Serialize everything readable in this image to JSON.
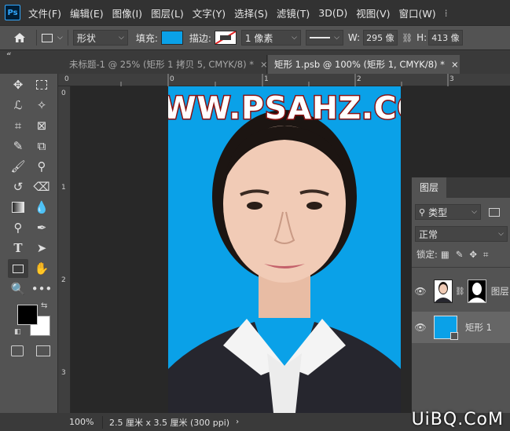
{
  "menubar": {
    "logo": "Ps",
    "items": [
      "文件(F)",
      "编辑(E)",
      "图像(I)",
      "图层(L)",
      "文字(Y)",
      "选择(S)",
      "滤镜(T)",
      "3D(D)",
      "视图(V)",
      "窗口(W)"
    ]
  },
  "options": {
    "mode": "形状",
    "fill_label": "填充:",
    "stroke_label": "描边:",
    "stroke_width": "1 像素",
    "w_label": "W:",
    "w_value": "295 像",
    "h_label": "H:",
    "h_value": "413 像",
    "fill_color": "#0aa1e8"
  },
  "tabs": [
    {
      "label": "未标题-1 @ 25% (矩形 1 拷贝 5, CMYK/8) *",
      "close": "×"
    },
    {
      "label": "矩形 1.psb @ 100% (矩形 1, CMYK/8) *",
      "close": "×"
    }
  ],
  "collapse_glyph": "«",
  "rulers": {
    "top": [
      "0",
      "0",
      "1",
      "2",
      "3"
    ],
    "left": [
      "0",
      "1",
      "2",
      "3"
    ]
  },
  "canvas": {
    "headline": "WWW.PSAHZ.COM",
    "background_color": "#0aa1e8"
  },
  "layers_panel": {
    "title": "图层",
    "filter_kind": "类型",
    "blend_mode": "正常",
    "lock_label": "锁定:",
    "layers": [
      {
        "name": "图层",
        "visible": true
      },
      {
        "name": "矩形 1",
        "visible": true
      }
    ]
  },
  "status": {
    "zoom": "100%",
    "doc_info": "2.5 厘米 x 3.5 厘米 (300 ppi)"
  },
  "watermark": "UiBQ.CoM"
}
